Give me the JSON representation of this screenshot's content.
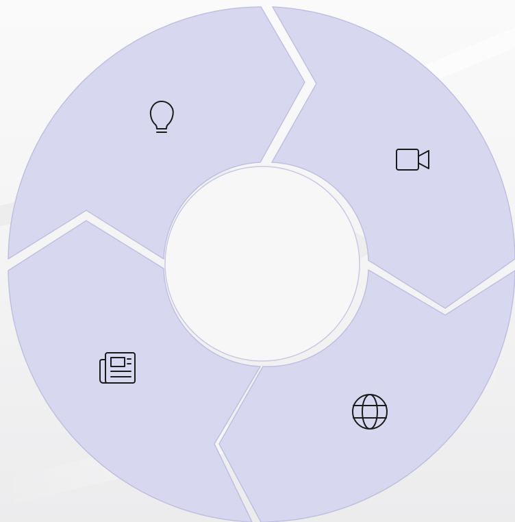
{
  "colors": {
    "background": "#f5f5f6",
    "segment_fill": "#d8d7f0",
    "segment_stroke": "#c0bfe0",
    "hole_fill": "#f7f7f8",
    "icon_stroke": "#1a1a1a"
  },
  "diagram": {
    "type": "cycle",
    "segments": [
      {
        "id": "top-left",
        "icon": "lightbulb-icon"
      },
      {
        "id": "top-right",
        "icon": "video-camera-icon"
      },
      {
        "id": "bottom-right",
        "icon": "globe-icon"
      },
      {
        "id": "bottom-left",
        "icon": "newspaper-icon"
      }
    ]
  }
}
